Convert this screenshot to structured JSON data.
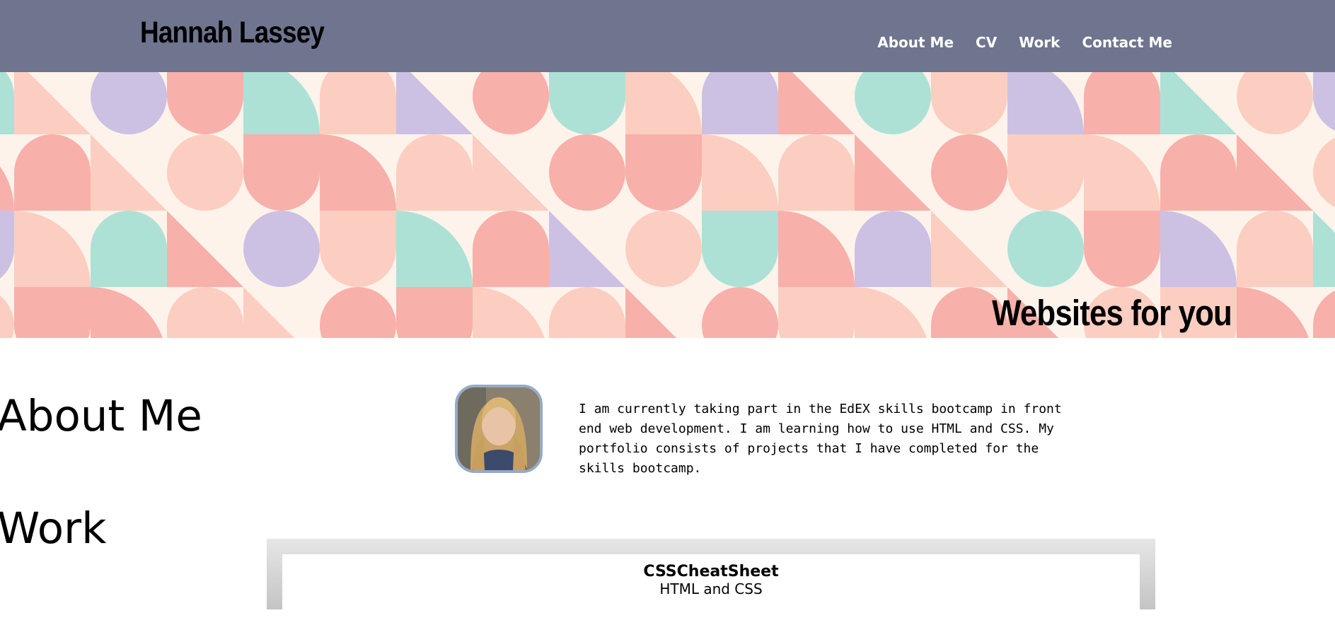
{
  "header": {
    "site_title": "Hannah Lassey",
    "nav": [
      {
        "label": "About Me"
      },
      {
        "label": "CV"
      },
      {
        "label": "Work"
      },
      {
        "label": "Contact Me"
      }
    ]
  },
  "hero": {
    "tagline": "Websites for you"
  },
  "about": {
    "heading": "About Me",
    "text": "I am currently taking part in the EdEX skills bootcamp in front end web development. I am learning how to use HTML and CSS. My portfolio consists of projects that I have completed for the skills bootcamp."
  },
  "work": {
    "heading": "Work",
    "projects": [
      {
        "title": "CSSCheatSheet",
        "subtitle": "HTML and CSS"
      }
    ]
  },
  "colors": {
    "header_bg": "#6f748f",
    "nav_text": "#ffffff",
    "avatar_border": "#95abc6",
    "mint": "#a6dfd4",
    "coral": "#f7aaa4",
    "lavender": "#c8bde2",
    "peach": "#fbcbbd",
    "cream": "#fdf3ea"
  }
}
